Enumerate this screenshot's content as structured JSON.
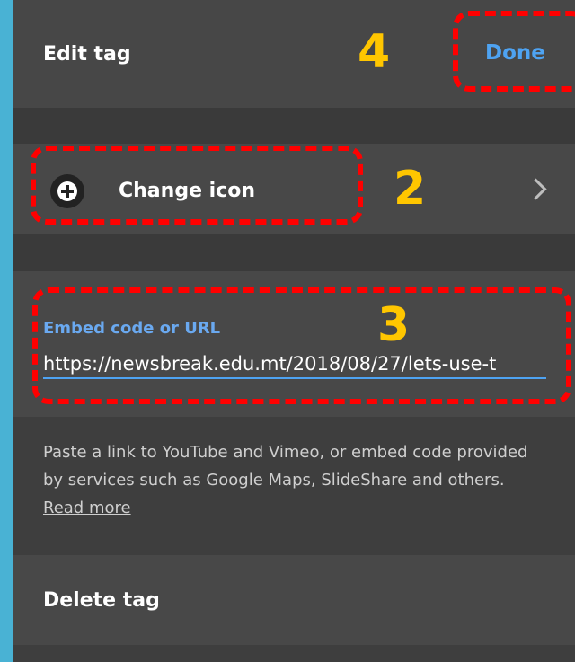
{
  "header": {
    "title": "Edit tag",
    "done_label": "Done"
  },
  "icon_row": {
    "label": "Change icon",
    "icon": "plus-circle-icon",
    "chevron": "chevron-right-icon"
  },
  "embed": {
    "label": "Embed code or URL",
    "value": "https://newsbreak.edu.mt/2018/08/27/lets-use-t"
  },
  "help": {
    "text": "Paste a link to YouTube and Vimeo, or embed code provided by services such as Google Maps, SlideShare and others.",
    "link": "Read more"
  },
  "delete": {
    "label": "Delete tag"
  },
  "annotations": {
    "done": "4",
    "icon": "2",
    "embed": "3"
  },
  "colors": {
    "accent": "#4ea3f2",
    "annotation_box": "#ff0000",
    "annotation_number": "#ffc600"
  }
}
